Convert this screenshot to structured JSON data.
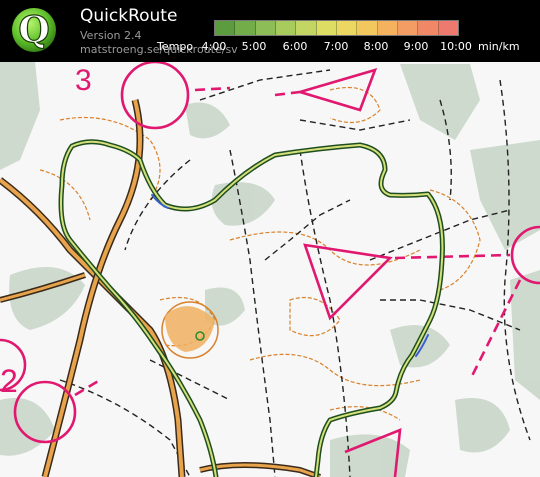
{
  "app": {
    "title": "QuickRoute",
    "version": "Version 2.4",
    "url": "matstroeng.se/quickroute/sv"
  },
  "logo": {
    "letter": "Q",
    "icon": "quickroute-logo-icon"
  },
  "tempo_scale": {
    "label": "Tempo",
    "unit": "min/km",
    "ticks": [
      "4:00",
      "5:00",
      "6:00",
      "7:00",
      "8:00",
      "9:00",
      "10:00"
    ],
    "colors": [
      "#5d9c3e",
      "#73ad4a",
      "#8dbd56",
      "#a8cb5e",
      "#c3d663",
      "#dddc63",
      "#ecd760",
      "#f2c85e",
      "#f4b25f",
      "#f39c63",
      "#f08868",
      "#ee7a6f"
    ]
  },
  "map": {
    "colors": {
      "paper": "#f7f7f7",
      "vegetation": "#c9d6c9",
      "path": "#222222",
      "road_fill": "#e8a34d",
      "road_edge": "#3a2a1a",
      "contour": "#d9822b",
      "course": "#e0186f",
      "route_outer": "#1f4e1f",
      "route_inner": "#d4e07a",
      "route_blue": "#3a60d0"
    }
  }
}
